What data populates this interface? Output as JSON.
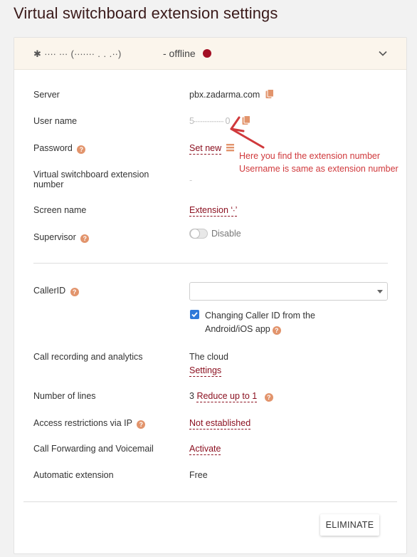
{
  "page": {
    "title": "Virtual switchboard extension settings"
  },
  "header": {
    "extension_name": "✱ ∙∙∙∙ ∙∙∙ (∙∙∙∙∙∙∙ . . .∙∙)",
    "status": "- offline",
    "status_color": "#a30f24"
  },
  "fields": {
    "server": {
      "label": "Server",
      "value": "pbx.zadarma.com"
    },
    "username": {
      "label": "User name",
      "value": "5∙∙∙∙∙∙∙∙∙∙∙∙∙∙∙∙∙ 0"
    },
    "password": {
      "label": "Password",
      "link": "Set new"
    },
    "extension_number": {
      "label": "Virtual switchboard extension number",
      "value": "‐"
    },
    "screen_name": {
      "label": "Screen name",
      "link": "Extension ‘∙’"
    },
    "supervisor": {
      "label": "Supervisor",
      "value": "Disable"
    },
    "callerid": {
      "label": "CallerID",
      "select_value": "",
      "checkbox_text": "Changing Caller ID from the Android/iOS app"
    },
    "recording": {
      "label": "Call recording and analytics",
      "value": "The cloud",
      "link": "Settings"
    },
    "lines": {
      "label": "Number of lines",
      "value": "3",
      "link": "Reduce up to 1"
    },
    "ip": {
      "label": "Access restrictions via IP",
      "link": "Not established"
    },
    "forwarding": {
      "label": "Call Forwarding and Voicemail",
      "link": "Activate"
    },
    "auto_ext": {
      "label": "Automatic extension",
      "value": "Free"
    }
  },
  "footer": {
    "button": "ELIMINATE"
  },
  "annotation": {
    "line1": "Here you find the extension number",
    "line2": "Username is same as extension number",
    "color": "#d0393c"
  },
  "icons": [
    "copy-icon",
    "help-icon",
    "chevron-down-icon",
    "password-icon",
    "arrow-annotation"
  ]
}
